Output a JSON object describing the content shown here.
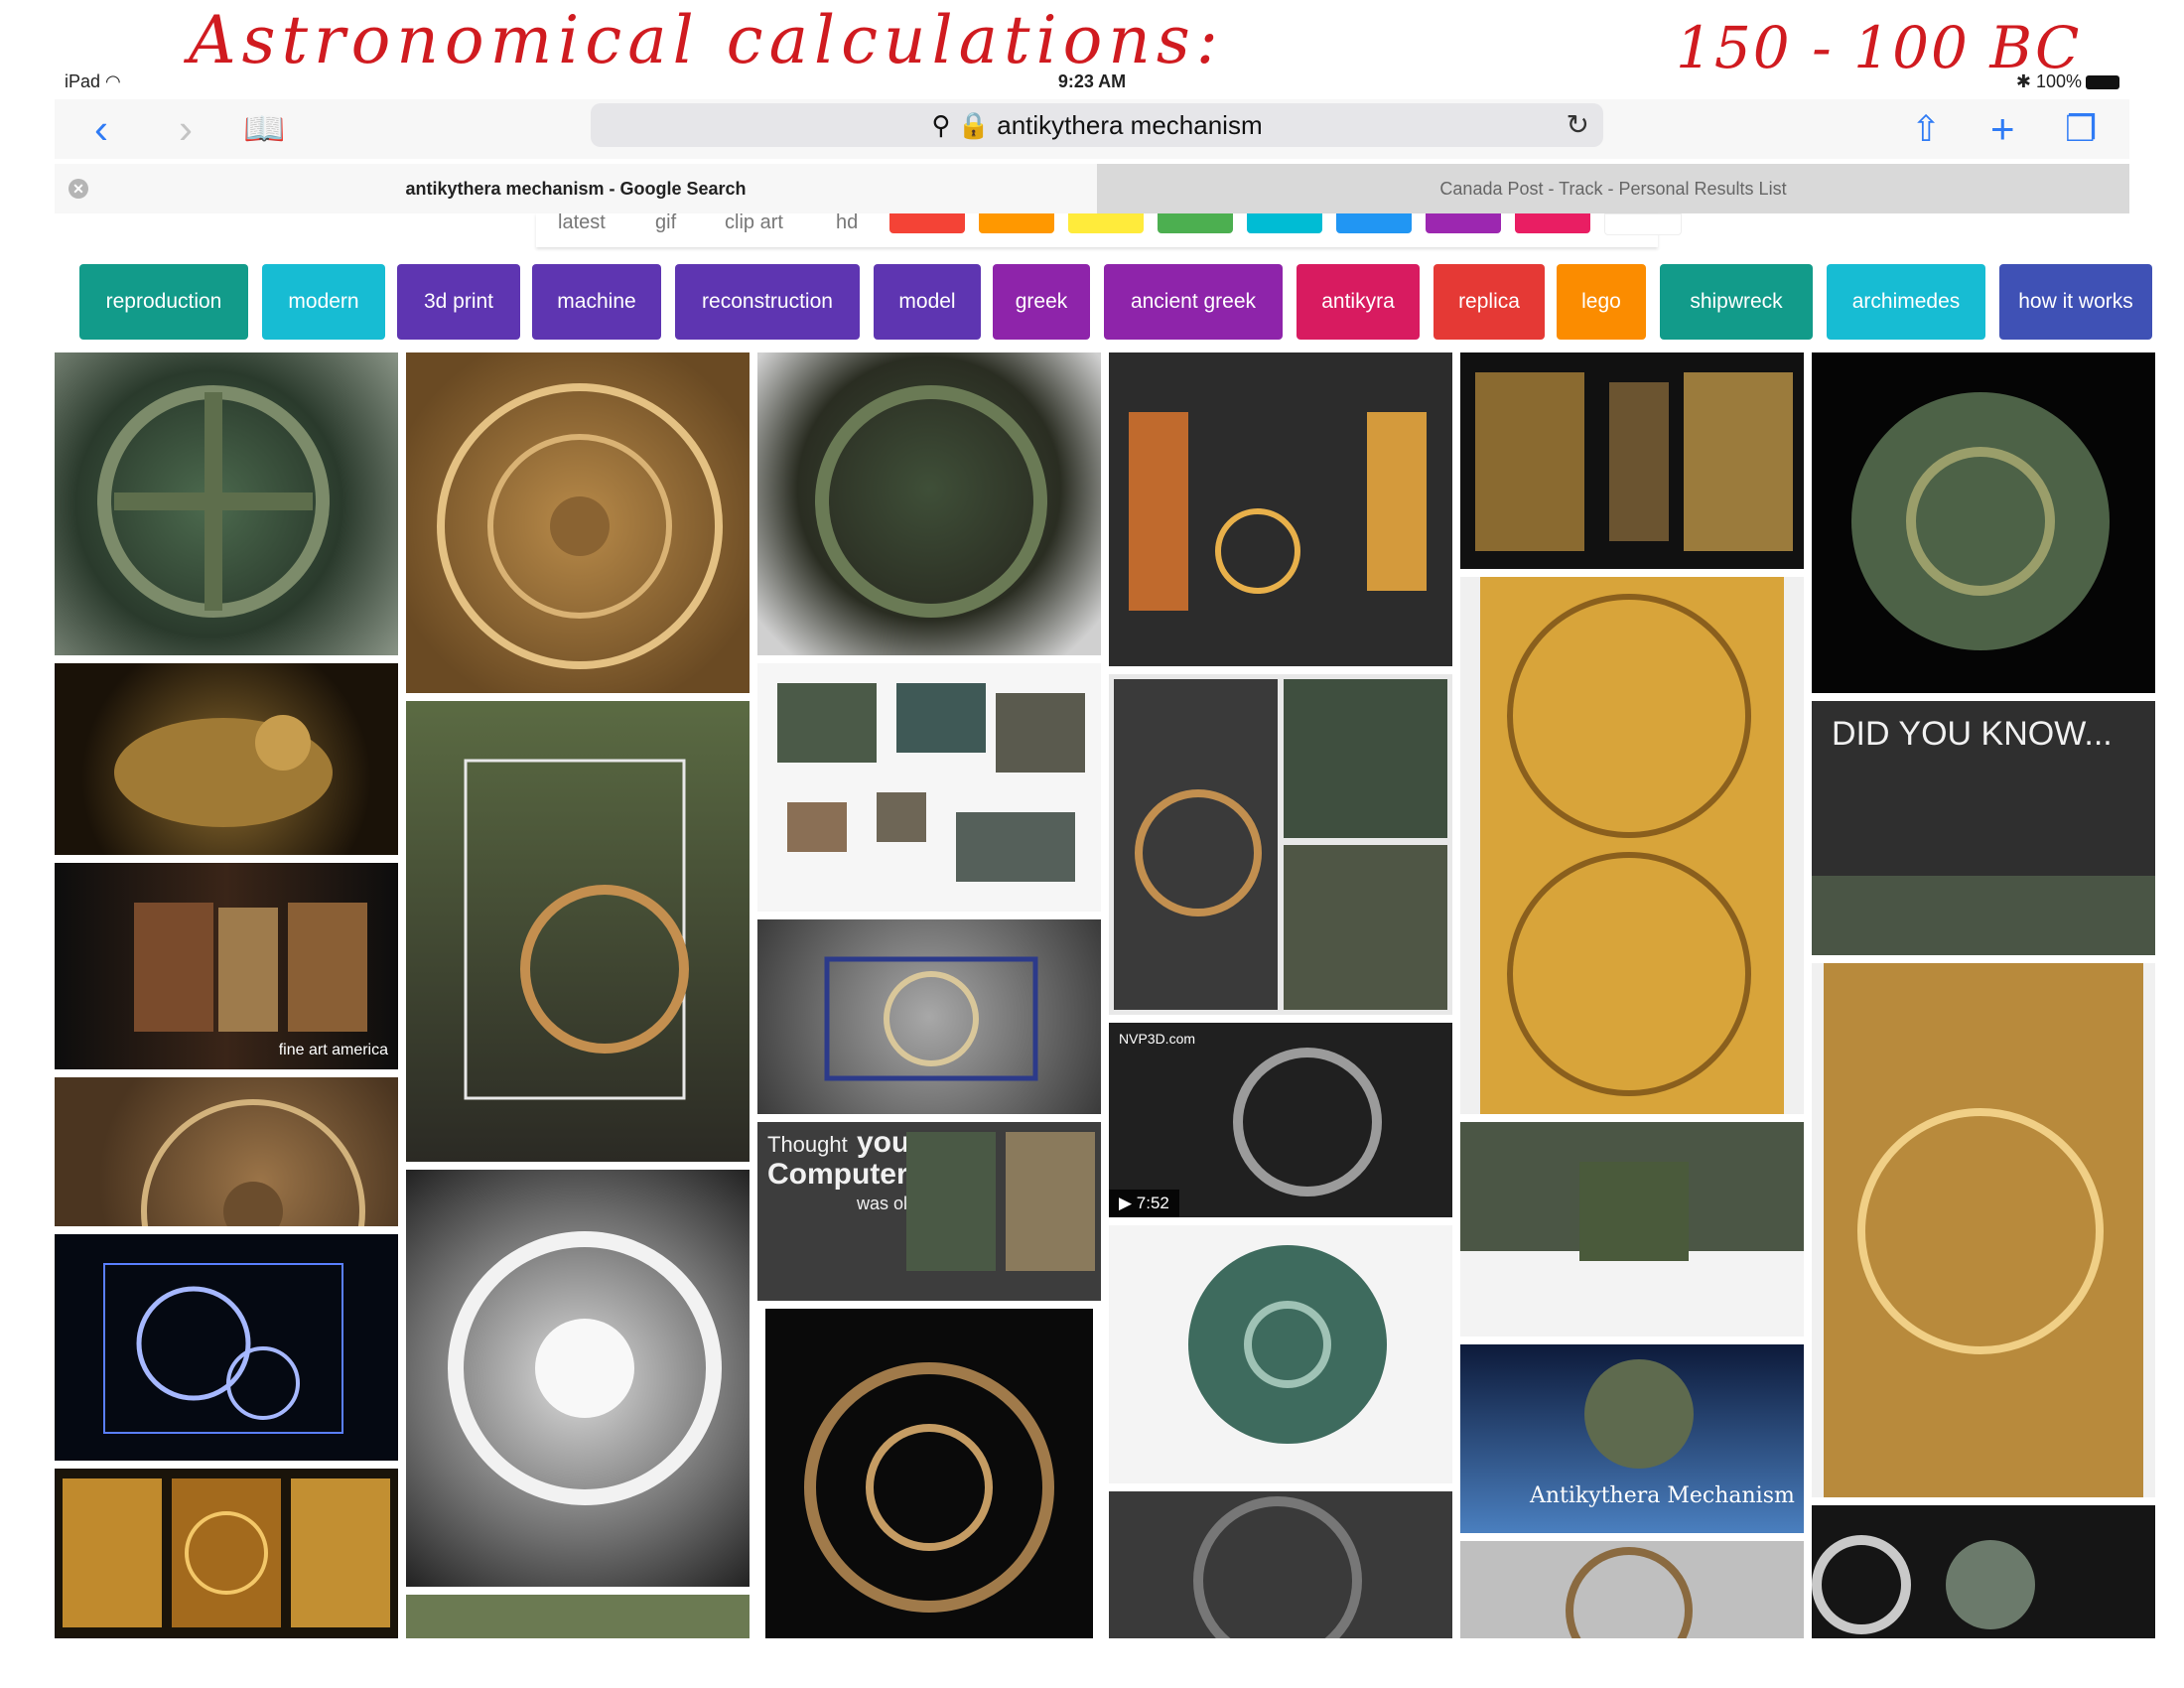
{
  "annotation": {
    "left": "Astronomical calculations:",
    "right": "150 - 100 BC"
  },
  "status_bar": {
    "device": "iPad",
    "time": "9:23 AM",
    "battery": "100%"
  },
  "browser": {
    "address_text": "antikythera mechanism",
    "tabs": [
      {
        "title": "antikythera mechanism - Google Search"
      },
      {
        "title": "Canada Post - Track - Personal Results List"
      }
    ]
  },
  "filters": [
    "latest",
    "gif",
    "clip art",
    "hd"
  ],
  "color_swatches": [
    "#f44336",
    "#ff9800",
    "#ffeb3b",
    "#4caf50",
    "#00bcd4",
    "#2196f3",
    "#9c27b0",
    "#e91e63",
    "#ffffff"
  ],
  "chips": [
    {
      "label": "reproduction",
      "color": "#129b8a"
    },
    {
      "label": "modern",
      "color": "#17bcd3"
    },
    {
      "label": "3d print",
      "color": "#5e35b1"
    },
    {
      "label": "machine",
      "color": "#5e35b1"
    },
    {
      "label": "reconstruction",
      "color": "#5e35b1"
    },
    {
      "label": "model",
      "color": "#5e35b1"
    },
    {
      "label": "greek",
      "color": "#8e24aa"
    },
    {
      "label": "ancient greek",
      "color": "#8e24aa"
    },
    {
      "label": "antikyra",
      "color": "#d81b60"
    },
    {
      "label": "replica",
      "color": "#e53935"
    },
    {
      "label": "lego",
      "color": "#fb8c00"
    },
    {
      "label": "shipwreck",
      "color": "#129b8a"
    },
    {
      "label": "archimedes",
      "color": "#17bcd3"
    },
    {
      "label": "how it works",
      "color": "#3f51b5"
    }
  ],
  "image_text": {
    "fineart": "fine art america",
    "did_you_know": "DID YOU KNOW...",
    "thought_line1": "Thought",
    "thought_line2": "your",
    "thought_line3": "Computer",
    "thought_line4": "was old?",
    "video_duration": "7:52",
    "nvp3d": "NVP3D.com",
    "antikythera_logo": "Antikythera Mechanism"
  }
}
